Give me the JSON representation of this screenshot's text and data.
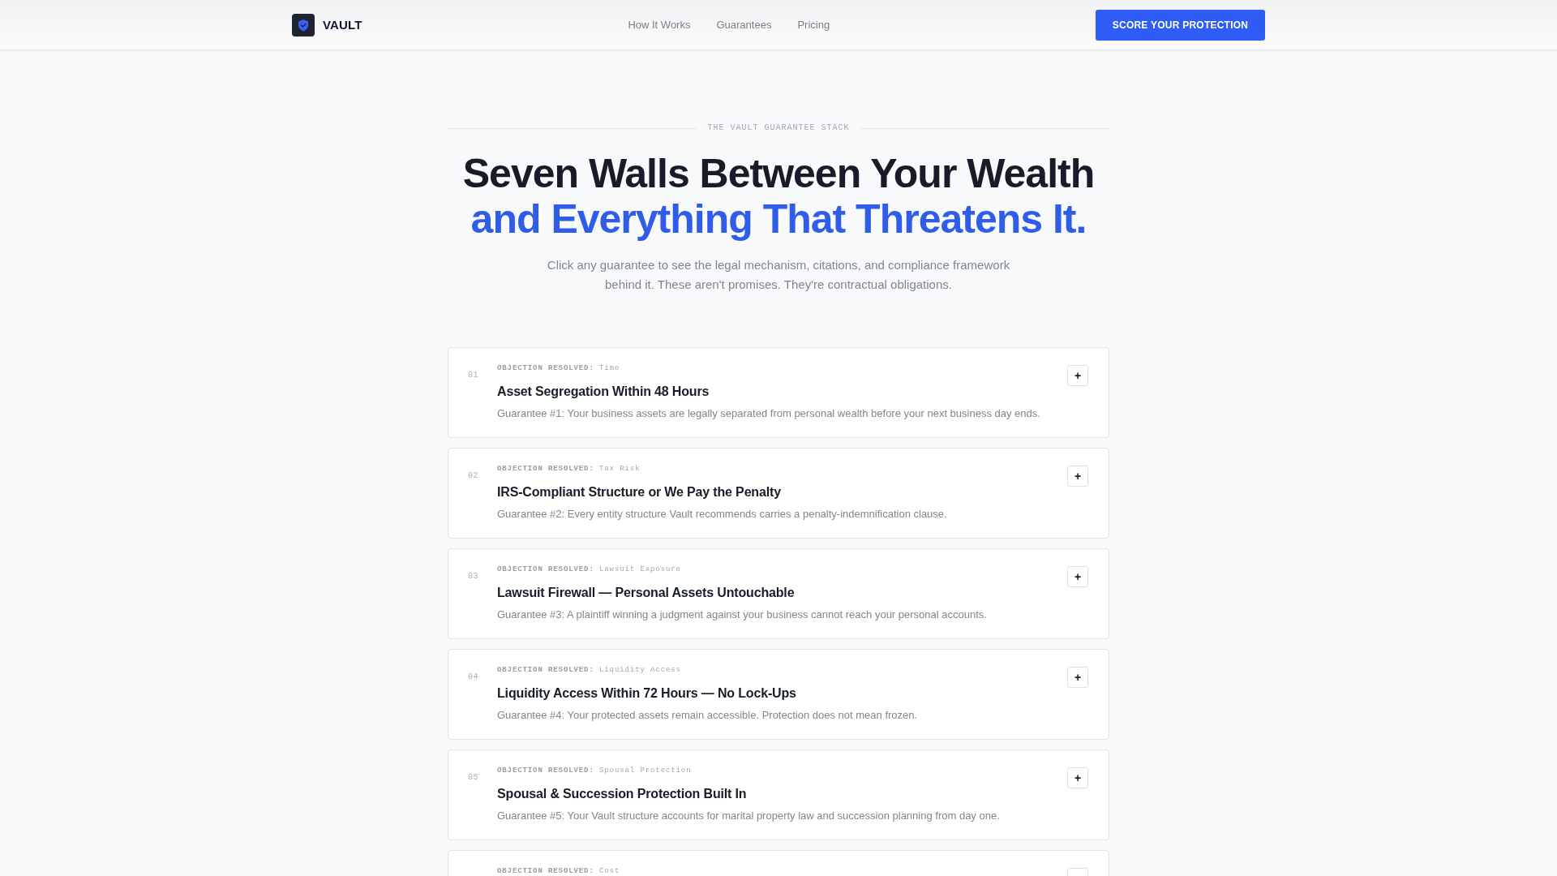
{
  "nav": {
    "brand": "VAULT",
    "links": [
      "How It Works",
      "Guarantees",
      "Pricing"
    ],
    "cta": "SCORE YOUR PROTECTION"
  },
  "hero": {
    "eyebrow": "THE VAULT GUARANTEE STACK",
    "title_line_1": "Seven Walls Between Your Wealth",
    "title_line_2": "and Everything That Threatens It.",
    "subtitle": "Click any guarantee to see the legal mechanism, citations, and compliance framework behind it. These aren't promises. They're contractual obligations."
  },
  "guarantees": [
    {
      "number": "01",
      "label": "**OBJECTION RESOLVED:** Time",
      "title": "Asset Segregation Within 48 Hours",
      "description": "Guarantee #1: Your business assets are legally separated from personal wealth before your next business day ends.",
      "toggle": "+"
    },
    {
      "number": "02",
      "label": "**OBJECTION RESOLVED:** Tax Risk",
      "title": "IRS-Compliant Structure or We Pay the Penalty",
      "description": "Guarantee #2: Every entity structure Vault recommends carries a penalty-indemnification clause.",
      "toggle": "+"
    },
    {
      "number": "03",
      "label": "**OBJECTION RESOLVED:** Lawsuit Exposure",
      "title": "Lawsuit Firewall — Personal Assets Untouchable",
      "description": "Guarantee #3: A plaintiff winning a judgment against your business cannot reach your personal accounts.",
      "toggle": "+"
    },
    {
      "number": "04",
      "label": "**OBJECTION RESOLVED:** Liquidity Access",
      "title": "Liquidity Access Within 72 Hours — No Lock-Ups",
      "description": "Guarantee #4: Your protected assets remain accessible. Protection does not mean frozen.",
      "toggle": "+"
    },
    {
      "number": "05",
      "label": "**OBJECTION RESOLVED:** Spousal Protection",
      "title": "Spousal & Succession Protection Built In",
      "description": "Guarantee #5: Your Vault structure accounts for marital property law and succession planning from day one.",
      "toggle": "+"
    },
    {
      "label": "**OBJECTION RESOLVED:** Cost"
    }
  ]
}
